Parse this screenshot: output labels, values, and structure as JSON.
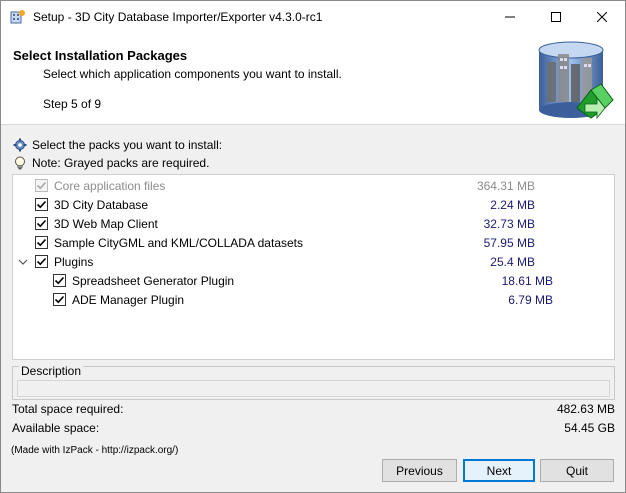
{
  "window": {
    "title": "Setup - 3D City Database Importer/Exporter v4.3.0-rc1",
    "controls": [
      "minimize-icon",
      "maximize-icon",
      "close-icon"
    ]
  },
  "header": {
    "title": "Select Installation Packages",
    "subtitle": "Select which application components you want to install.",
    "step": "Step 5 of 9",
    "logo_icon": "3d-city-database-logo"
  },
  "info": {
    "select_text": "Select the packs you want to install:",
    "select_icon": "gear-icon",
    "note_text": "Note: Grayed packs are required.",
    "note_icon": "lightbulb-icon"
  },
  "packs": [
    {
      "label": "Core application files",
      "size": "364.31 MB",
      "checked": true,
      "disabled": true
    },
    {
      "label": "3D City Database",
      "size": "2.24 MB",
      "checked": true,
      "disabled": false
    },
    {
      "label": "3D Web Map Client",
      "size": "32.73 MB",
      "checked": true,
      "disabled": false
    },
    {
      "label": "Sample CityGML and KML/COLLADA datasets",
      "size": "57.95 MB",
      "checked": true,
      "disabled": false
    },
    {
      "label": "Plugins",
      "size": "25.4 MB",
      "checked": true,
      "disabled": false,
      "expanded": true
    },
    {
      "label": "Spreadsheet Generator Plugin",
      "size": "18.61 MB",
      "checked": true,
      "disabled": false
    },
    {
      "label": "ADE Manager Plugin",
      "size": "6.79 MB",
      "checked": true,
      "disabled": false
    }
  ],
  "description": {
    "legend": "Description",
    "text": ""
  },
  "space": {
    "required_label": "Total space required:",
    "required_value": "482.63 MB",
    "available_label": "Available space:",
    "available_value": "54.45 GB"
  },
  "footer": {
    "made_with": "(Made with IzPack - http://izpack.org/)",
    "previous_label": "Previous",
    "next_label": "Next",
    "quit_label": "Quit"
  },
  "colors": {
    "accent": "#0078d7",
    "size_text": "#1a1a6e",
    "disabled_text": "#8d8d8d"
  }
}
